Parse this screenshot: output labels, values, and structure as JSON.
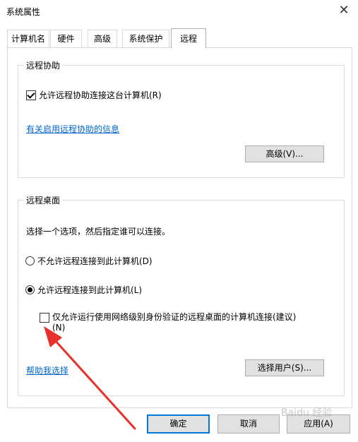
{
  "window": {
    "title": "系统属性",
    "close_glyph": "✕"
  },
  "tabs": [
    {
      "label": "计算机名"
    },
    {
      "label": "硬件"
    },
    {
      "label": "高级"
    },
    {
      "label": "系统保护"
    },
    {
      "label": "远程",
      "active": true
    }
  ],
  "remote_assistance": {
    "group_label": "远程协助",
    "checkbox_label": "允许远程协助连接这台计算机(R)",
    "checked": true,
    "info_link": "有关启用远程协助的信息",
    "advanced_button": "高级(V)..."
  },
  "remote_desktop": {
    "group_label": "远程桌面",
    "instruction": "选择一个选项，然后指定谁可以连接。",
    "option_deny": "不允许远程连接到此计算机(D)",
    "option_allow": "允许远程连接到此计算机(L)",
    "selected": "allow",
    "nla_checkbox_line1": "仅允许运行使用网络级别身份验证的远程桌面的计算机连接(建议)",
    "nla_checkbox_line2": "(N)",
    "nla_checked": false,
    "help_link": "帮助我选择",
    "select_users_button": "选择用户(S)..."
  },
  "footer": {
    "ok": "确定",
    "cancel": "取消",
    "apply": "应用(A)"
  },
  "annotation": {
    "arrow_color": "#e8302c"
  },
  "watermark": {
    "text": "Baidu 经验"
  }
}
